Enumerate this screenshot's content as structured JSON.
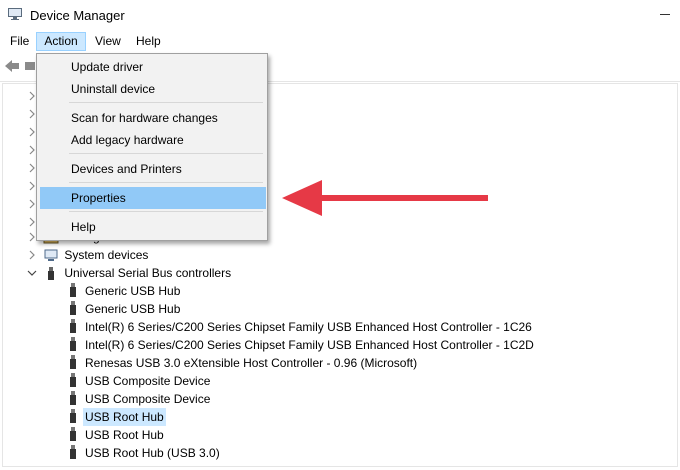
{
  "window": {
    "title": "Device Manager"
  },
  "menubar": {
    "items": [
      "File",
      "Action",
      "View",
      "Help"
    ]
  },
  "action_menu": {
    "items": [
      "Update driver",
      "Uninstall device",
      "Scan for hardware changes",
      "Add legacy hardware",
      "Devices and Printers",
      "Properties",
      "Help"
    ],
    "highlighted": "Properties"
  },
  "tree": {
    "partial_label": "Storage controllers",
    "system_devices": "System devices",
    "usb_controllers": "Universal Serial Bus controllers",
    "usb_children": [
      "Generic USB Hub",
      "Generic USB Hub",
      "Intel(R) 6 Series/C200 Series Chipset Family USB Enhanced Host Controller - 1C26",
      "Intel(R) 6 Series/C200 Series Chipset Family USB Enhanced Host Controller - 1C2D",
      "Renesas USB 3.0 eXtensible Host Controller - 0.96 (Microsoft)",
      "USB Composite Device",
      "USB Composite Device",
      "USB Root Hub",
      "USB Root Hub",
      "USB Root Hub (USB 3.0)"
    ],
    "selected": "USB Root Hub"
  },
  "colors": {
    "accent": "#cce8ff",
    "menu_highlight": "#91c9f7",
    "annotation_arrow": "#e63946"
  }
}
